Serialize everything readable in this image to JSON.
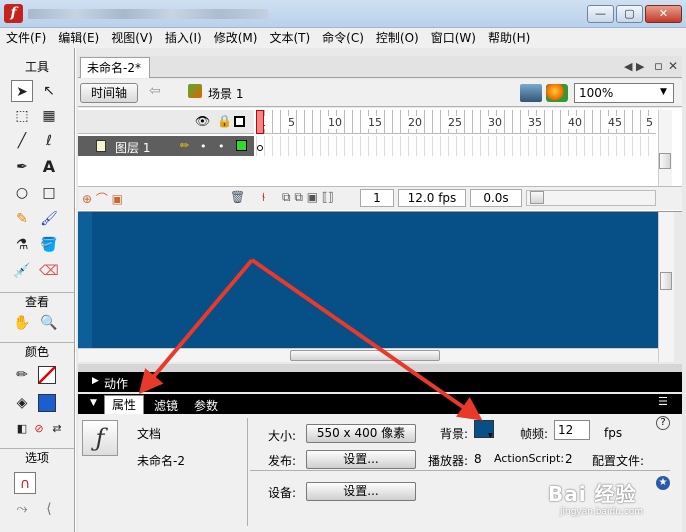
{
  "window": {
    "title": "",
    "buttons": {
      "minimize": "—",
      "maximize": "▢",
      "close": "✕"
    }
  },
  "menu": [
    "文件(F)",
    "编辑(E)",
    "视图(V)",
    "插入(I)",
    "修改(M)",
    "文本(T)",
    "命令(C)",
    "控制(O)",
    "窗口(W)",
    "帮助(H)"
  ],
  "tools": {
    "sections": {
      "tools": "工具",
      "view": "查看",
      "colors": "颜色",
      "options": "选项"
    }
  },
  "document": {
    "tab": "未命名-2*",
    "timeline_button": "时间轴",
    "scene": "场景 1",
    "zoom": "100%"
  },
  "timeline": {
    "frame_numbers": [
      "1",
      "5",
      "10",
      "15",
      "20",
      "25",
      "30",
      "35",
      "40",
      "45",
      "5"
    ],
    "layer_name": "图层 1",
    "current_frame": "1",
    "fps": "12.0 fps",
    "time": "0.0s"
  },
  "panels": {
    "actions": "动作",
    "properties": "属性",
    "filters": "滤镜",
    "parameters": "参数"
  },
  "properties": {
    "type_label": "文档",
    "doc_name": "未命名-2",
    "size_label": "大小:",
    "size_value": "550 x 400 像素",
    "publish_label": "发布:",
    "publish_button": "设置...",
    "background_label": "背景:",
    "background_color": "#064f87",
    "frame_rate_label": "帧频:",
    "frame_rate_value": "12",
    "fps_unit": "fps",
    "player_label": "播放器:",
    "player_value": "8",
    "actionscript_label": "ActionScript:",
    "actionscript_value": "2",
    "profile_label": "配置文件:",
    "device_label": "设备:",
    "device_button": "设置..."
  },
  "watermark": {
    "main": "Bai 经验",
    "sub": "jingyan.baidu.com"
  },
  "colors": {
    "stage": "#064f87",
    "accent_arrow": "#e8392a",
    "layer_color": "#2eda2e"
  }
}
